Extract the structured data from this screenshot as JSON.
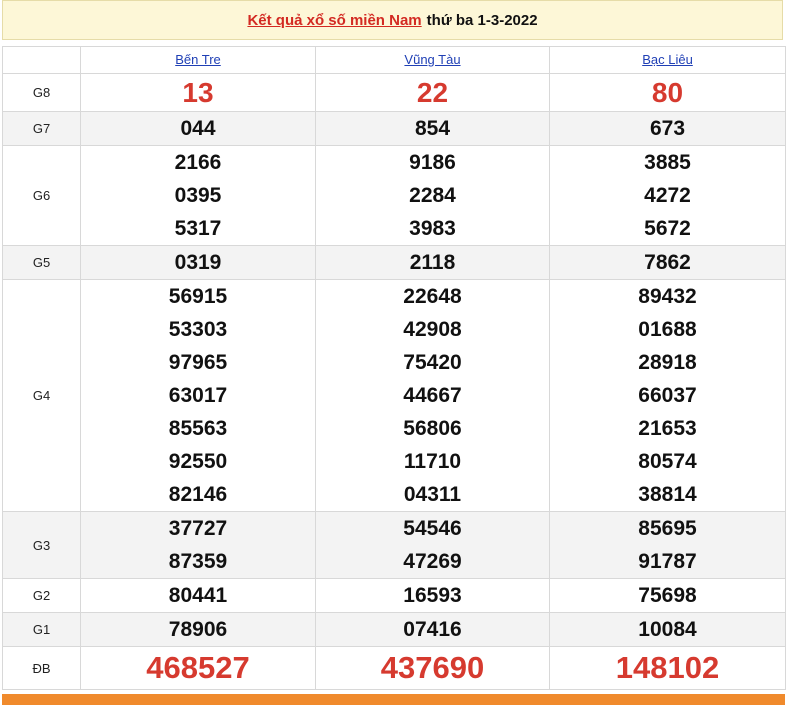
{
  "title": {
    "link_text": "Kết quả xổ số miền Nam",
    "rest_text": "thứ ba 1-3-2022"
  },
  "provinces": [
    "Bến Tre",
    "Vũng Tàu",
    "Bạc Liêu"
  ],
  "prizes": [
    {
      "label": "G8",
      "style": "big",
      "values": [
        [
          "13"
        ],
        [
          "22"
        ],
        [
          "80"
        ]
      ]
    },
    {
      "label": "G7",
      "style": "normal",
      "values": [
        [
          "044"
        ],
        [
          "854"
        ],
        [
          "673"
        ]
      ]
    },
    {
      "label": "G6",
      "style": "normal",
      "values": [
        [
          "2166",
          "0395",
          "5317"
        ],
        [
          "9186",
          "2284",
          "3983"
        ],
        [
          "3885",
          "4272",
          "5672"
        ]
      ]
    },
    {
      "label": "G5",
      "style": "normal",
      "values": [
        [
          "0319"
        ],
        [
          "2118"
        ],
        [
          "7862"
        ]
      ]
    },
    {
      "label": "G4",
      "style": "normal",
      "values": [
        [
          "56915",
          "53303",
          "97965",
          "63017",
          "85563",
          "92550",
          "82146"
        ],
        [
          "22648",
          "42908",
          "75420",
          "44667",
          "56806",
          "11710",
          "04311"
        ],
        [
          "89432",
          "01688",
          "28918",
          "66037",
          "21653",
          "80574",
          "38814"
        ]
      ]
    },
    {
      "label": "G3",
      "style": "normal",
      "values": [
        [
          "37727",
          "87359"
        ],
        [
          "54546",
          "47269"
        ],
        [
          "85695",
          "91787"
        ]
      ]
    },
    {
      "label": "G2",
      "style": "normal",
      "values": [
        [
          "80441"
        ],
        [
          "16593"
        ],
        [
          "75698"
        ]
      ]
    },
    {
      "label": "G1",
      "style": "normal",
      "values": [
        [
          "78906"
        ],
        [
          "07416"
        ],
        [
          "10084"
        ]
      ]
    },
    {
      "label": "ĐB",
      "style": "huge",
      "values": [
        [
          "468527"
        ],
        [
          "437690"
        ],
        [
          "148102"
        ]
      ]
    }
  ],
  "bottom_bar": {
    "color": "#f08a2c"
  }
}
